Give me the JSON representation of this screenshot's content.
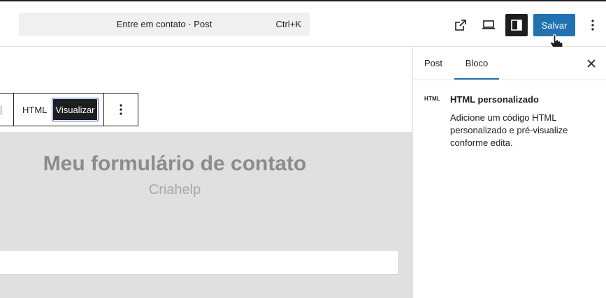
{
  "header": {
    "command_title": "Entre em contato · Post",
    "shortcut": "Ctrl+K",
    "save_label": "Salvar",
    "icons": [
      "external-link-icon",
      "desktop-preview-icon",
      "settings-panel-icon",
      "more-vertical-icon"
    ]
  },
  "block_toolbar": {
    "html_label": "HTML",
    "preview_label": "Visualizar"
  },
  "preview": {
    "title": "Meu formulário de contato",
    "subtitle": "Criahelp"
  },
  "sidebar": {
    "tabs": [
      {
        "label": "Post",
        "active": false
      },
      {
        "label": "Bloco",
        "active": true
      }
    ],
    "block": {
      "icon_text": "HTML",
      "name": "HTML personalizado",
      "description": "Adicione um código HTML personalizado e pré-visualize conforme edita."
    }
  },
  "colors": {
    "accent": "#2271b1",
    "dark": "#1e1e1e",
    "preview_bg": "#e0e0e0"
  }
}
